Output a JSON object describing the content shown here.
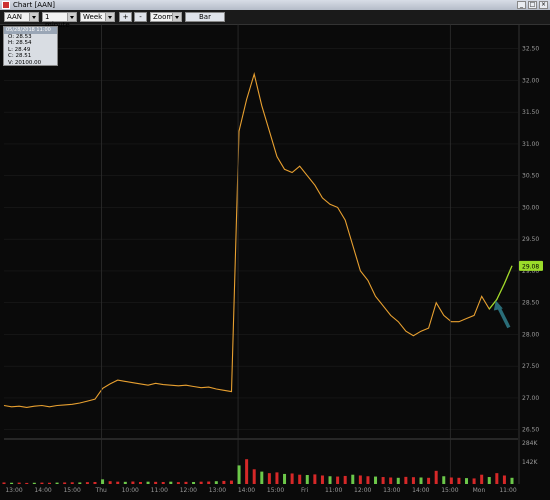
{
  "window": {
    "title": "Chart [AAN]"
  },
  "toolbar": {
    "symbol": "AAN",
    "interval": "1 minute",
    "range": "Week",
    "plus_label": "+",
    "minus_label": "-",
    "zoom": "Zoom",
    "bar_label": "Bar"
  },
  "infobox": {
    "header": "05/28/2018 11:00",
    "open": "O: 28.53",
    "high": "H: 28.54",
    "low": "L: 28.49",
    "close": "C: 28.51",
    "volume": "V: 20100.00"
  },
  "colors": {
    "background": "#0a0a0a",
    "price": "#e8a030",
    "accent_price": "#9bdc2a",
    "volume_up": "#d62828",
    "volume_dn": "#6cc84a",
    "arrow": "#2a6d78"
  },
  "chart_data": {
    "type": "line",
    "price_axis": {
      "labels": [
        "32.50",
        "32.00",
        "31.50",
        "31.00",
        "30.50",
        "30.00",
        "29.50",
        "29.00",
        "28.50",
        "28.00",
        "27.50",
        "27.00",
        "26.50"
      ],
      "ylim": [
        26.4,
        32.7
      ]
    },
    "volume_axis": {
      "labels": [
        "284K",
        "142K"
      ]
    },
    "current_price_label": "29.08",
    "day_separators": [
      "Thu",
      "Fri",
      "Mon"
    ],
    "time_labels": [
      "13:00",
      "14:00",
      "15:00",
      "Thu",
      "10:00",
      "11:00",
      "12:00",
      "13:00",
      "14:00",
      "15:00",
      "Fri",
      "11:00",
      "12:00",
      "13:00",
      "14:00",
      "15:00",
      "Mon",
      "11:00"
    ],
    "series": [
      {
        "values": [
          26.88,
          26.86,
          26.87,
          26.85,
          26.87,
          26.88,
          26.86,
          26.88,
          26.89,
          26.9,
          26.92,
          26.95,
          26.98,
          27.15,
          27.22,
          27.28,
          27.26,
          27.24,
          27.22,
          27.2,
          27.23,
          27.21,
          27.2,
          27.19,
          27.2,
          27.18,
          27.16,
          27.17,
          27.14,
          27.12,
          27.1,
          31.2,
          31.7,
          32.1,
          31.6,
          31.2,
          30.8,
          30.6,
          30.55,
          30.65,
          30.5,
          30.35,
          30.15,
          30.05,
          30.0,
          29.8,
          29.4,
          29.0,
          28.85,
          28.6,
          28.45,
          28.3,
          28.2,
          28.05,
          27.98,
          28.05,
          28.1,
          28.5,
          28.3,
          28.2,
          28.2,
          28.25,
          28.3,
          28.6,
          28.4,
          28.55,
          28.8,
          29.08
        ]
      }
    ],
    "volume_values": [
      10,
      8,
      9,
      7,
      8,
      9,
      8,
      9,
      10,
      11,
      10,
      12,
      13,
      30,
      18,
      15,
      14,
      16,
      13,
      15,
      14,
      13,
      15,
      12,
      14,
      13,
      15,
      16,
      18,
      20,
      22,
      120,
      160,
      95,
      80,
      70,
      75,
      65,
      68,
      60,
      58,
      62,
      55,
      50,
      48,
      52,
      60,
      55,
      50,
      48,
      45,
      42,
      40,
      46,
      44,
      42,
      40,
      85,
      50,
      42,
      40,
      38,
      36,
      60,
      45,
      70,
      55,
      40
    ]
  }
}
